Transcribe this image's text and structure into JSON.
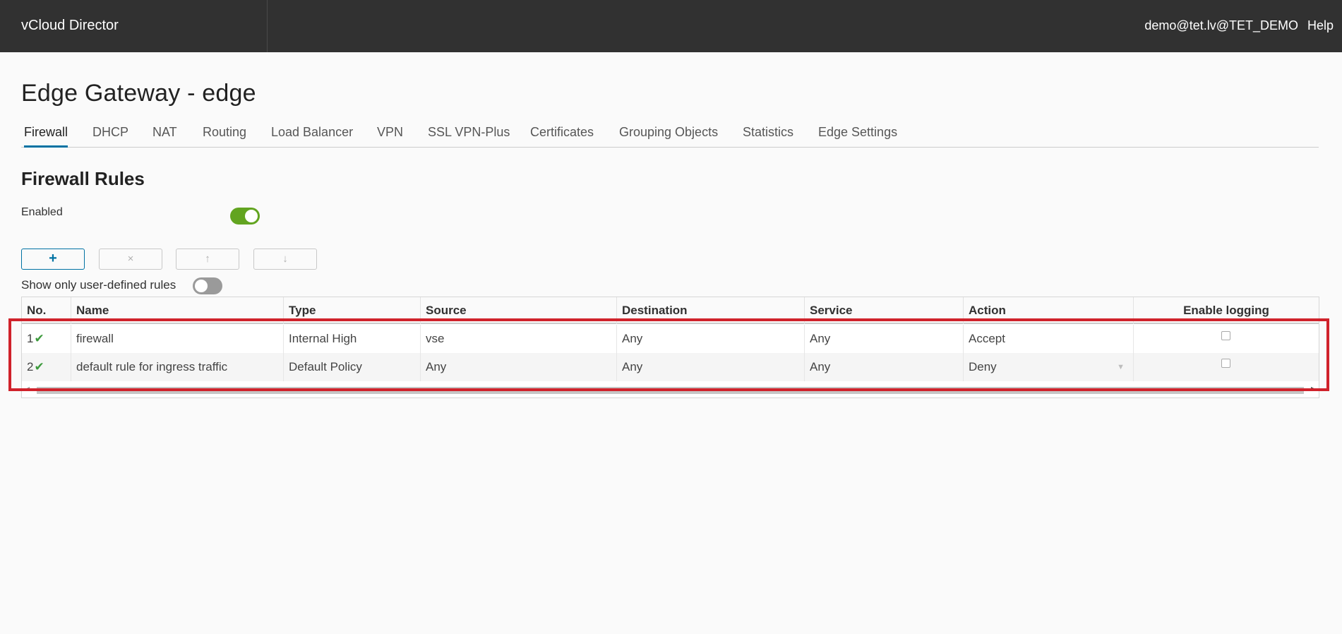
{
  "header": {
    "brand": "vCloud Director",
    "user": "demo@tet.lv@TET_DEMO",
    "help": "Help"
  },
  "page": {
    "title": "Edge Gateway - edge"
  },
  "tabs": [
    {
      "label": "Firewall",
      "active": true
    },
    {
      "label": "DHCP"
    },
    {
      "label": "NAT"
    },
    {
      "label": "Routing"
    },
    {
      "label": "Load Balancer"
    },
    {
      "label": "VPN"
    },
    {
      "label": "SSL VPN-Plus"
    },
    {
      "label": "Certificates"
    },
    {
      "label": "Grouping Objects"
    },
    {
      "label": "Statistics"
    },
    {
      "label": "Edge Settings"
    }
  ],
  "firewall": {
    "title": "Firewall Rules",
    "enabled_label": "Enabled",
    "enabled": true,
    "toolbar": {
      "add": "+",
      "delete": "×",
      "up": "↑",
      "down": "↓"
    },
    "user_defined_label": "Show only user-defined rules",
    "user_defined_only": false
  },
  "table": {
    "columns": [
      "No.",
      "Name",
      "Type",
      "Source",
      "Destination",
      "Service",
      "Action",
      "Enable logging"
    ],
    "rows": [
      {
        "no": "1",
        "enabled": true,
        "name": "firewall",
        "type": "Internal High",
        "source": "vse",
        "destination": "Any",
        "service": "Any",
        "action": "Accept",
        "logging": false
      },
      {
        "no": "2",
        "enabled": true,
        "name": "default rule for ingress traffic",
        "type": "Default Policy",
        "source": "Any",
        "destination": "Any",
        "service": "Any",
        "action": "Deny",
        "logging": false
      }
    ]
  },
  "icons": {
    "check": "✔",
    "dropdown": "▼",
    "scroll_left": "◂",
    "scroll_right": "▸"
  },
  "colors": {
    "topbar": "#313131",
    "accent": "#0072a3",
    "toggle_on": "#62a420",
    "check": "#3c9a3c",
    "highlight": "#d0222b"
  }
}
